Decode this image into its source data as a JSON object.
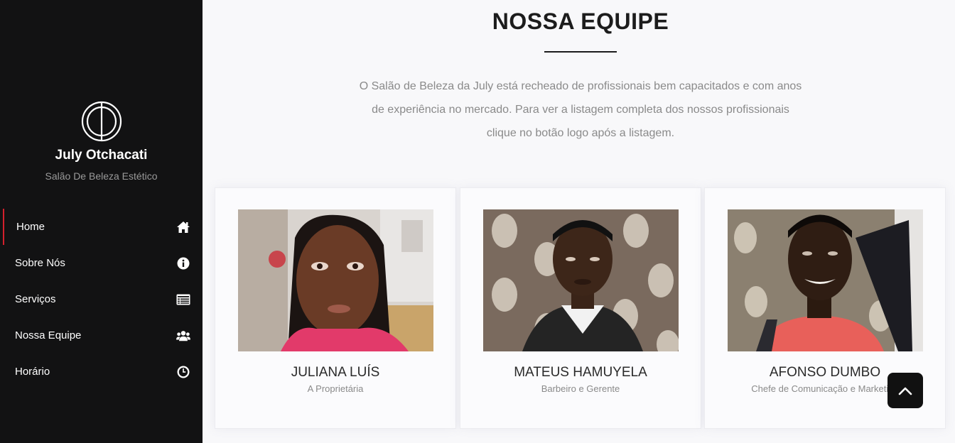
{
  "sidebar": {
    "brand_name": "July Otchacati",
    "brand_subtitle": "Salão De Beleza Estético",
    "logo_icon": "circle-line-logo",
    "items": [
      {
        "label": "Home",
        "icon": "home-icon",
        "active": true
      },
      {
        "label": "Sobre Nós",
        "icon": "info-icon",
        "active": false
      },
      {
        "label": "Serviços",
        "icon": "list-card-icon",
        "active": false
      },
      {
        "label": "Nossa Equipe",
        "icon": "users-icon",
        "active": false
      },
      {
        "label": "Horário",
        "icon": "clock-icon",
        "active": false
      }
    ],
    "accent_color": "#d4202c"
  },
  "main": {
    "title": "NOSSA EQUIPE",
    "intro": "O Salão de Beleza da July está recheado de profissionais bem capacitados e com anos de experiência no mercado. Para ver a listagem completa dos nossos profissionais clique no botão logo após a listagem.",
    "team": [
      {
        "name": "JULIANA LUÍS",
        "role": "A Proprietária"
      },
      {
        "name": "MATEUS HAMUYELA",
        "role": "Barbeiro e Gerente"
      },
      {
        "name": "AFONSO DUMBO",
        "role": "Chefe de Comunicação e Marketing"
      }
    ]
  },
  "back_to_top": {
    "icon": "chevron-up-icon"
  }
}
